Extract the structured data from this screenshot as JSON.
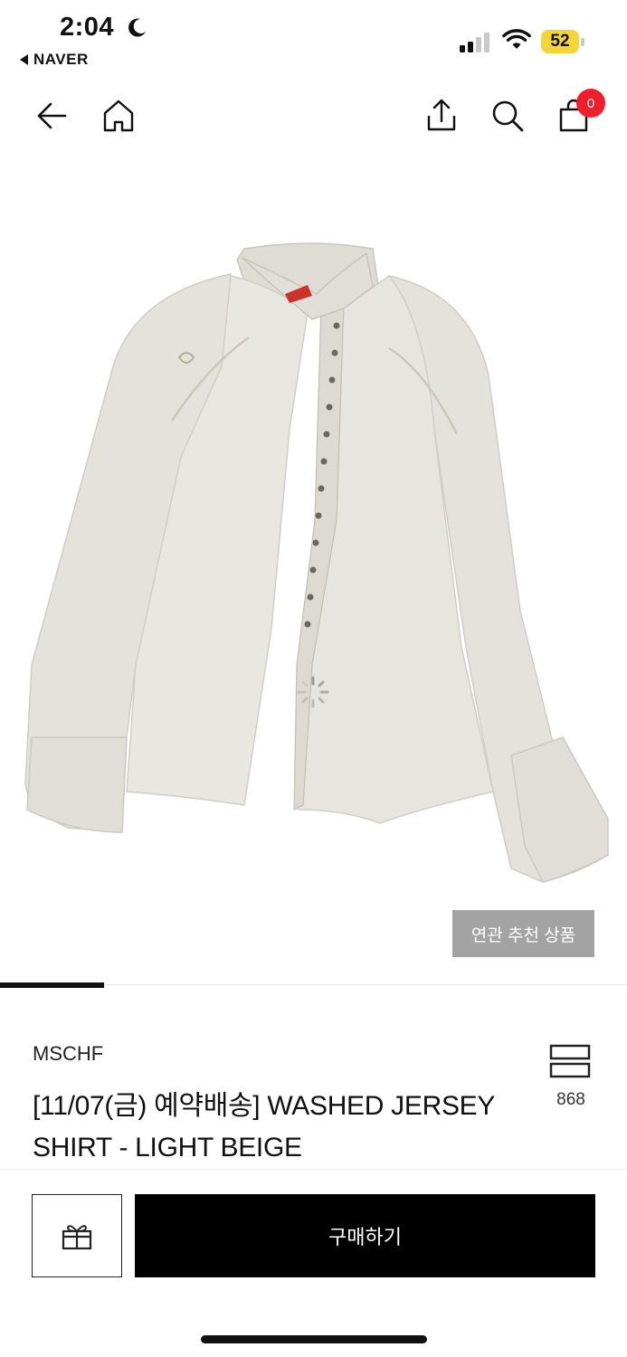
{
  "status_bar": {
    "time": "2:04",
    "back_app": "NAVER",
    "battery": "52"
  },
  "nav": {
    "icons": [
      "back-arrow-icon",
      "home-icon",
      "share-icon",
      "search-icon",
      "shopping-bag-icon"
    ],
    "cart_count": "0"
  },
  "product": {
    "image_alt": "washed jersey shirt light beige",
    "related_button": "연관 추천 상품",
    "gallery_progress": 0.166,
    "brand": "MSCHF",
    "title": "[11/07(금) 예약배송]  WASHED JERSEY SHIRT - LIGHT BEIGE",
    "wish_count": "868"
  },
  "actions": {
    "gift_icon": "gift-icon",
    "buy_label": "구매하기"
  },
  "colors": {
    "accent_badge": "#f21d2b",
    "battery": "#f2d636",
    "buy_button": "#000000",
    "related_button": "#a3a3a3"
  }
}
